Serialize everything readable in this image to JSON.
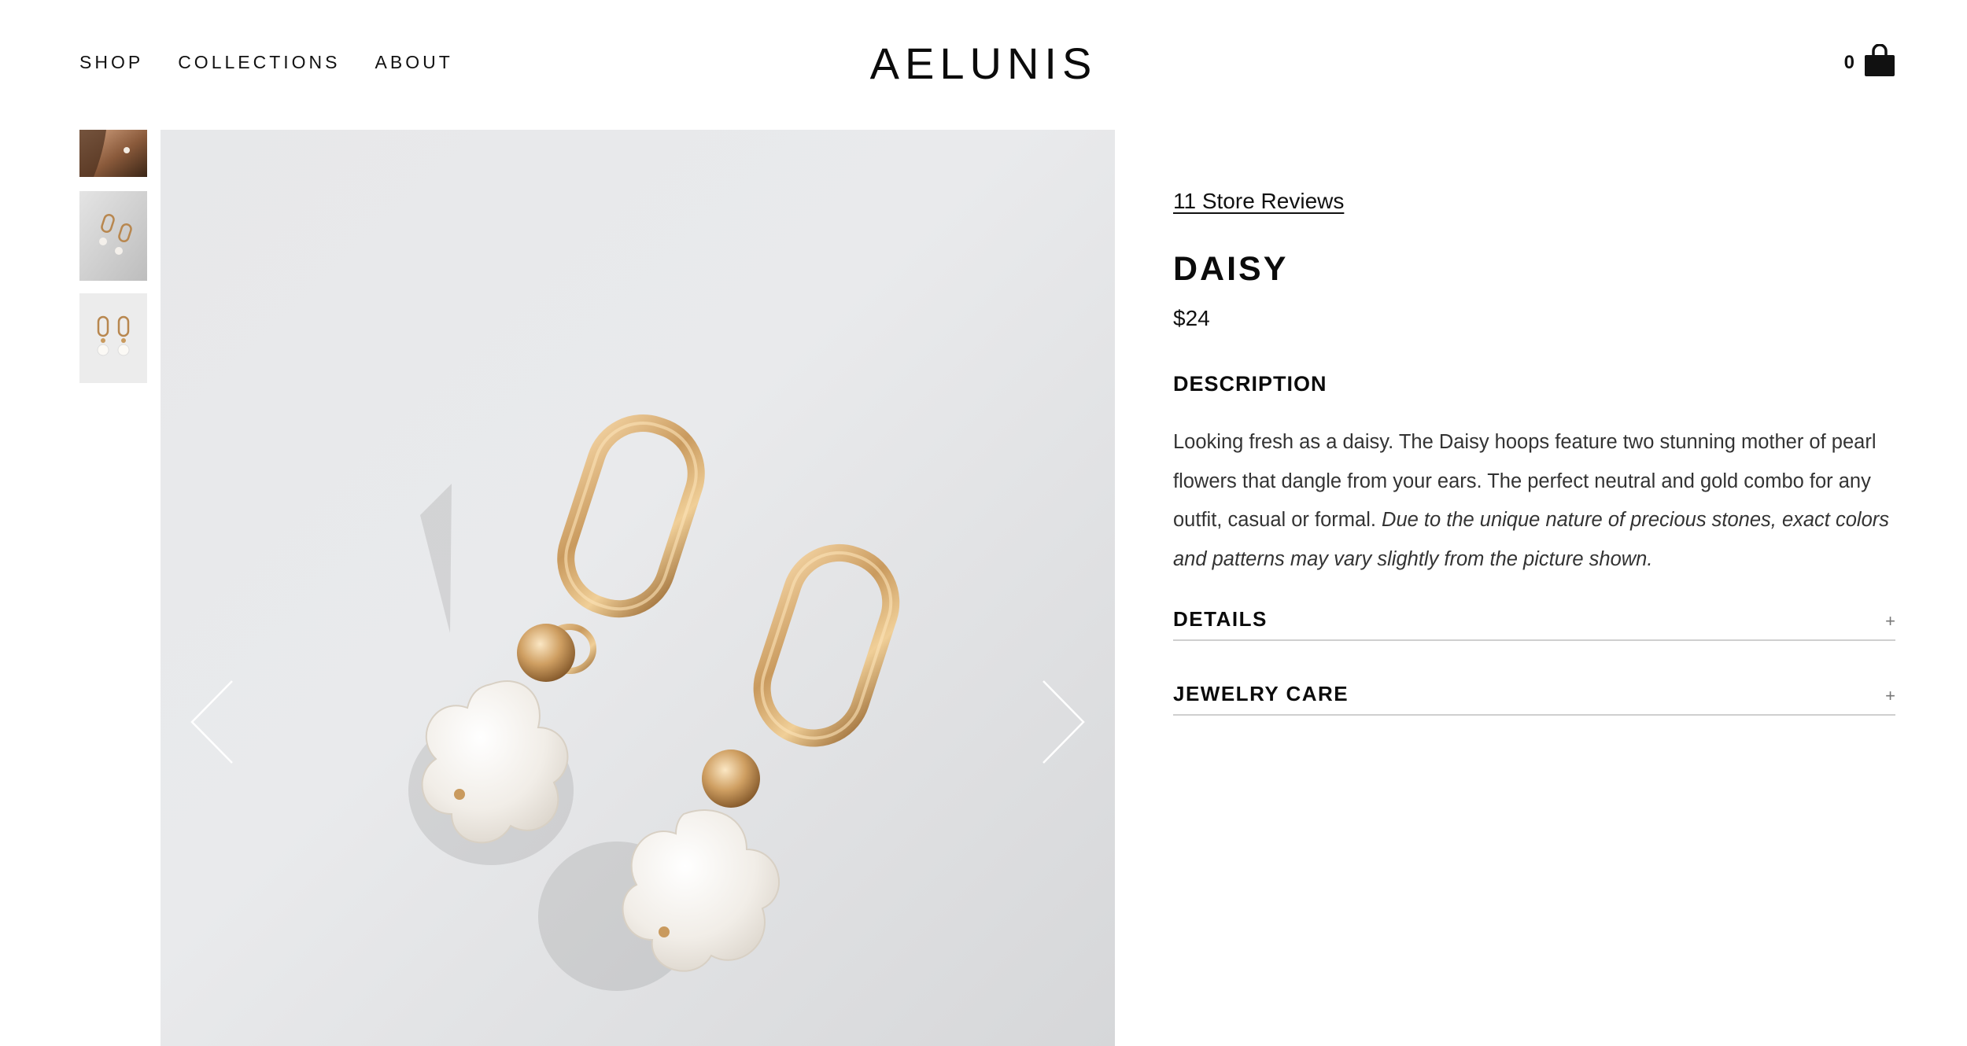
{
  "header": {
    "nav": [
      {
        "label": "SHOP"
      },
      {
        "label": "COLLECTIONS"
      },
      {
        "label": "ABOUT"
      }
    ],
    "logo": "AELUNIS",
    "cart_count": "0",
    "cart_icon": "shopping-bag-icon"
  },
  "gallery": {
    "thumbnails": [
      {
        "alt": "Model wearing earring"
      },
      {
        "alt": "Earrings on white surface"
      },
      {
        "alt": "Earrings flat lay"
      }
    ],
    "prev_icon": "chevron-left-icon",
    "next_icon": "chevron-right-icon"
  },
  "product": {
    "reviews_link": "11 Store Reviews",
    "title": "DAISY",
    "price": "$24",
    "description_heading": "DESCRIPTION",
    "description_text": "Looking fresh as a daisy. The Daisy hoops feature two stunning mother of pearl flowers that dangle from your ears. The perfect neutral and gold combo for any outfit, casual or formal. ",
    "description_note": "Due to the unique nature of precious stones, exact colors and patterns may vary slightly from the picture shown.",
    "accordions": [
      {
        "label": "DETAILS",
        "toggle": "+"
      },
      {
        "label": "JEWELRY CARE",
        "toggle": "+"
      }
    ]
  },
  "colors": {
    "text": "#111111",
    "background": "#ffffff",
    "divider": "#cfcfcf",
    "gold": "#c99a5e"
  }
}
